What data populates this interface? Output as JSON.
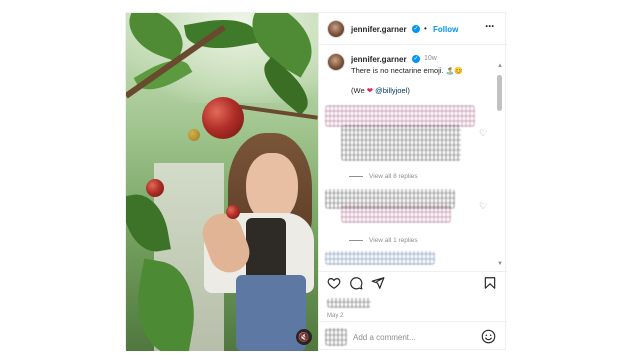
{
  "header": {
    "username": "jennifer.garner",
    "separator": "•",
    "follow_label": "Follow",
    "more_icon": "more-options-icon"
  },
  "caption": {
    "username": "jennifer.garner",
    "time": "10w",
    "line1": "There is no nectarine emoji.",
    "line1_emojis": "🏝️😊",
    "line2_prefix": "(We",
    "line2_heart": "❤",
    "line2_mention": "@billyjoel",
    "line2_suffix": ")"
  },
  "comments": [
    {
      "view_replies_label": "View all 8 replies"
    },
    {
      "view_replies_label": "View all 1 replies"
    }
  ],
  "actions": {
    "like_icon": "heart-icon",
    "comment_icon": "comment-icon",
    "share_icon": "send-icon",
    "save_icon": "bookmark-icon"
  },
  "post_date": "May 2",
  "add_comment": {
    "placeholder": "Add a comment..."
  },
  "media": {
    "mute_icon": "speaker-muted-icon",
    "mute_glyph": "🔇"
  },
  "colors": {
    "link_blue": "#0095f6",
    "mention_blue": "#00376b",
    "heart_red": "#e0245e",
    "muted_text": "#8e8e8e"
  }
}
